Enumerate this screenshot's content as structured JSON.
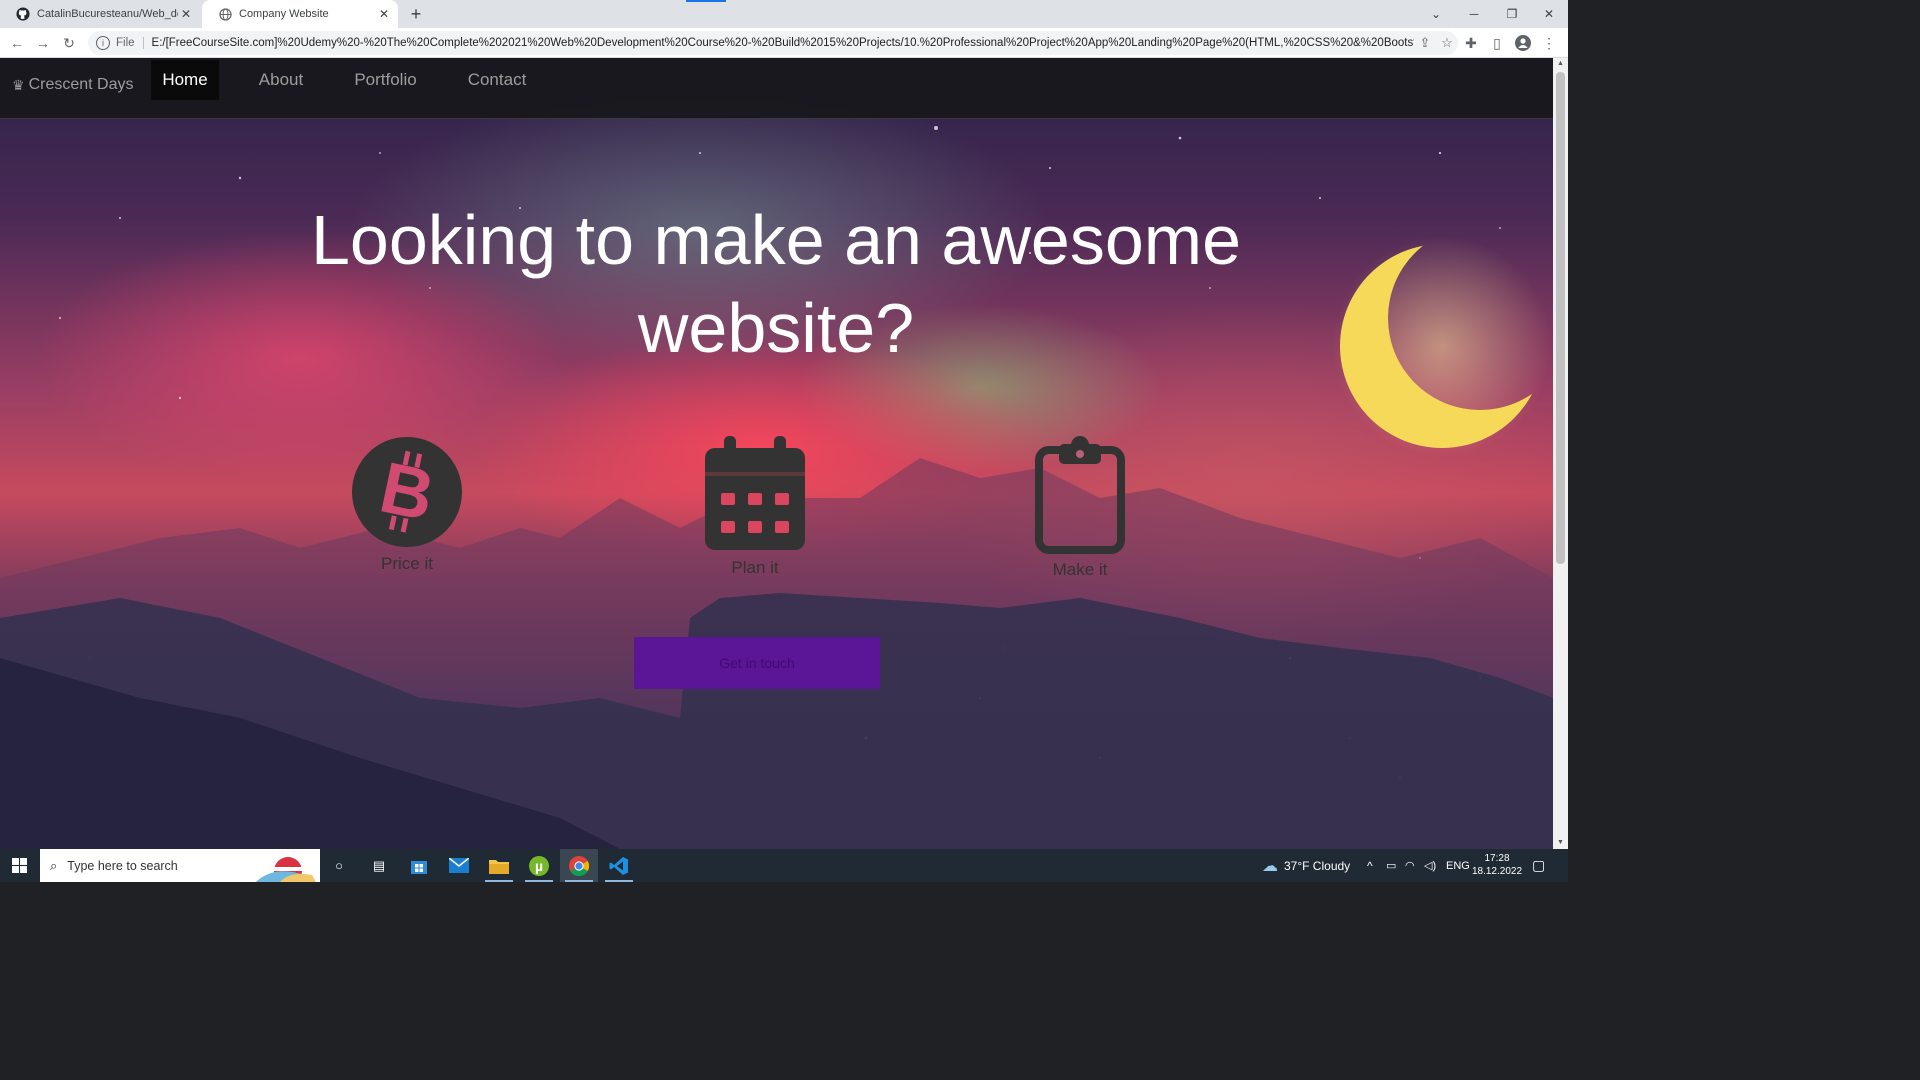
{
  "browser": {
    "tabs": [
      {
        "title": "CatalinBucuresteanu/Web_develo"
      },
      {
        "title": "Company Website"
      }
    ],
    "new_tab": "+",
    "window_controls": {
      "minimize": "─",
      "restore": "❐",
      "close": "✕"
    },
    "address": {
      "scheme_label": "File",
      "url": "E:/[FreeCourseSite.com]%20Udemy%20-%20The%20Complete%202021%20Web%20Development%20Course%20-%20Build%2015%20Projects/10.%20Professional%20Project%20App%20Landing%20Page%20(HTML,%20CSS%20&%20Bootstrap)/..."
    }
  },
  "site": {
    "brand": "Crescent Days",
    "nav": [
      {
        "label": "Home",
        "active": true
      },
      {
        "label": "About",
        "active": false
      },
      {
        "label": "Portfolio",
        "active": false
      },
      {
        "label": "Contact",
        "active": false
      }
    ],
    "headline": "Looking to make an awesome website?",
    "features": [
      {
        "label": "Price it",
        "icon": "bitcoin-icon"
      },
      {
        "label": "Plan it",
        "icon": "calendar-icon"
      },
      {
        "label": "Make it",
        "icon": "clipboard-icon"
      }
    ],
    "cta_label": "Get in touch",
    "colors": {
      "navbar": "#18181b",
      "feature_icon": "#333333",
      "cta": "#5b1597",
      "moon": "#f7d95a"
    }
  },
  "taskbar": {
    "search_placeholder": "Type here to search",
    "weather": "37°F  Cloudy",
    "language": "ENG",
    "time": "17:28",
    "date": "18.12.2022"
  }
}
